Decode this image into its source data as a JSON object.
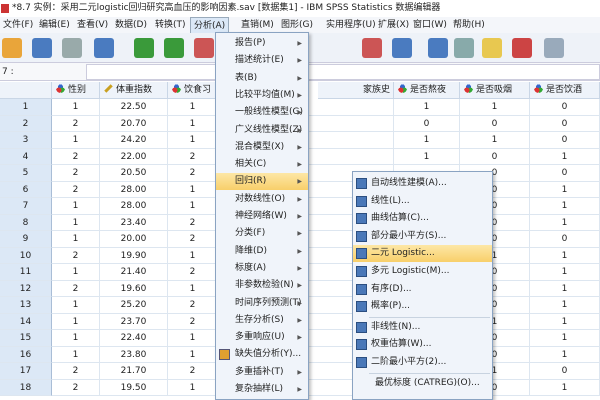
{
  "window": {
    "title": "*8.7 实例：采用二元logistic回归研究高血压的影响因素.sav [数据集1] - IBM SPSS Statistics 数据编辑器"
  },
  "menubar": [
    "文件(F)",
    "编辑(E)",
    "查看(V)",
    "数据(D)",
    "转换(T)",
    "分析(A)",
    "直销(M)",
    "图形(G)",
    "实用程序(U)",
    "扩展(X)",
    "窗口(W)",
    "帮助(H)"
  ],
  "toolbar": {
    "icons": [
      "open-icon",
      "save-icon",
      "print-icon",
      "dialog-recall-icon",
      "undo-icon",
      "redo-icon",
      "goto-case-icon",
      "insert-cases-icon",
      "insert-variable-icon",
      "split-file-icon",
      "weight-cases-icon",
      "select-cases-icon",
      "value-labels-icon",
      "use-sets-icon"
    ]
  },
  "cell_editor": {
    "ref": "7 :",
    "value": ""
  },
  "grid": {
    "columns": [
      "性别",
      "体重指数",
      "饮食习",
      "家族史",
      "是否熬夜",
      "是否吸烟",
      "是否饮酒"
    ],
    "rows": [
      {
        "n": "1",
        "sex": "1",
        "bmi": "22.50",
        "diet": "1",
        "late": "1",
        "smoke": "1",
        "drink": "0"
      },
      {
        "n": "2",
        "sex": "2",
        "bmi": "20.70",
        "diet": "1",
        "late": "0",
        "smoke": "0",
        "drink": "0"
      },
      {
        "n": "3",
        "sex": "1",
        "bmi": "24.20",
        "diet": "1",
        "late": "1",
        "smoke": "1",
        "drink": "0"
      },
      {
        "n": "4",
        "sex": "2",
        "bmi": "22.00",
        "diet": "2",
        "late": "1",
        "smoke": "0",
        "drink": "1"
      },
      {
        "n": "5",
        "sex": "2",
        "bmi": "20.50",
        "diet": "2",
        "late": "",
        "smoke": "0",
        "drink": "0"
      },
      {
        "n": "6",
        "sex": "2",
        "bmi": "28.00",
        "diet": "1",
        "late": "",
        "smoke": "0",
        "drink": "1"
      },
      {
        "n": "7",
        "sex": "1",
        "bmi": "28.00",
        "diet": "1",
        "late": "",
        "smoke": "0",
        "drink": "1"
      },
      {
        "n": "8",
        "sex": "1",
        "bmi": "23.40",
        "diet": "2",
        "late": "",
        "smoke": "0",
        "drink": "1"
      },
      {
        "n": "9",
        "sex": "1",
        "bmi": "20.00",
        "diet": "2",
        "late": "",
        "smoke": "0",
        "drink": "0"
      },
      {
        "n": "10",
        "sex": "2",
        "bmi": "19.90",
        "diet": "1",
        "late": "",
        "smoke": "1",
        "drink": "1"
      },
      {
        "n": "11",
        "sex": "1",
        "bmi": "21.40",
        "diet": "2",
        "late": "",
        "smoke": "0",
        "drink": "1"
      },
      {
        "n": "12",
        "sex": "2",
        "bmi": "19.60",
        "diet": "1",
        "late": "",
        "smoke": "0",
        "drink": "1"
      },
      {
        "n": "13",
        "sex": "1",
        "bmi": "25.20",
        "diet": "2",
        "late": "",
        "smoke": "0",
        "drink": "1"
      },
      {
        "n": "14",
        "sex": "1",
        "bmi": "23.70",
        "diet": "2",
        "late": "",
        "smoke": "1",
        "drink": "1"
      },
      {
        "n": "15",
        "sex": "1",
        "bmi": "22.40",
        "diet": "1",
        "late": "",
        "smoke": "0",
        "drink": "1"
      },
      {
        "n": "16",
        "sex": "1",
        "bmi": "23.80",
        "diet": "1",
        "late": "",
        "smoke": "0",
        "drink": "1"
      },
      {
        "n": "17",
        "sex": "2",
        "bmi": "21.70",
        "diet": "2",
        "late": "",
        "smoke": "1",
        "drink": "0"
      },
      {
        "n": "18",
        "sex": "2",
        "bmi": "19.50",
        "diet": "1",
        "late": "",
        "smoke": "0",
        "drink": "1"
      }
    ]
  },
  "analyze_menu": [
    {
      "label": "报告(P)",
      "sub": true
    },
    {
      "label": "描述统计(E)",
      "sub": true
    },
    {
      "label": "表(B)",
      "sub": true
    },
    {
      "label": "比较平均值(M)",
      "sub": true
    },
    {
      "label": "一般线性模型(G)",
      "sub": true
    },
    {
      "label": "广义线性模型(Z)",
      "sub": true
    },
    {
      "label": "混合模型(X)",
      "sub": true
    },
    {
      "label": "相关(C)",
      "sub": true
    },
    {
      "label": "回归(R)",
      "sub": true,
      "highlight": true
    },
    {
      "label": "对数线性(O)",
      "sub": true
    },
    {
      "label": "神经网络(W)",
      "sub": true
    },
    {
      "label": "分类(F)",
      "sub": true
    },
    {
      "label": "降维(D)",
      "sub": true
    },
    {
      "label": "标度(A)",
      "sub": true
    },
    {
      "label": "非参数检验(N)",
      "sub": true
    },
    {
      "label": "时间序列预测(T)",
      "sub": true
    },
    {
      "label": "生存分析(S)",
      "sub": true
    },
    {
      "label": "多重响应(U)",
      "sub": true
    },
    {
      "label": "缺失值分析(Y)...",
      "sub": false,
      "icon": true
    },
    {
      "label": "多重插补(T)",
      "sub": true
    },
    {
      "label": "复杂抽样(L)",
      "sub": true
    }
  ],
  "regression_menu": [
    {
      "label": "自动线性建模(A)..."
    },
    {
      "label": "线性(L)..."
    },
    {
      "label": "曲线估算(C)..."
    },
    {
      "label": "部分最小平方(S)..."
    },
    {
      "label": "二元 Logistic...",
      "highlight": true
    },
    {
      "label": "多元 Logistic(M)..."
    },
    {
      "label": "有序(D)..."
    },
    {
      "label": "概率(P)..."
    },
    {
      "label": "非线性(N)..."
    },
    {
      "label": "权重估算(W)..."
    },
    {
      "label": "二阶最小平方(2)..."
    },
    {
      "label": "最优标度 (CATREG)(O)...",
      "noicon": true
    }
  ]
}
